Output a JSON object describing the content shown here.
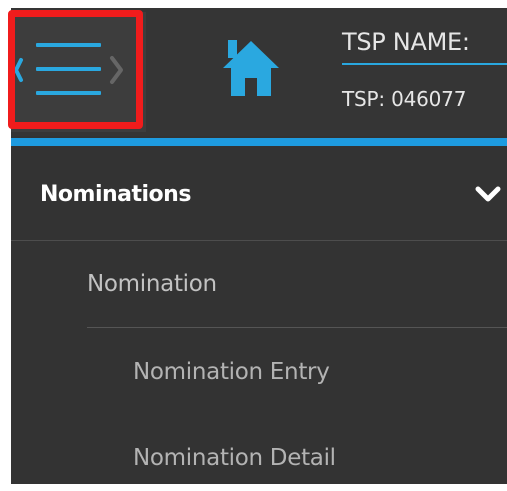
{
  "header": {
    "tsp_name_label": "TSP NAME:",
    "tsp_code_label": "TSP: 046077",
    "accent_color": "#1e9be0",
    "menu_icon": "hamburger-menu-icon",
    "home_icon": "home-icon"
  },
  "nav": {
    "group": {
      "label": "Nominations",
      "icon": "chevron-down-icon"
    },
    "sub": {
      "label": "Nomination"
    },
    "items": [
      {
        "label": "Nomination Entry"
      },
      {
        "label": "Nomination Detail"
      }
    ]
  }
}
